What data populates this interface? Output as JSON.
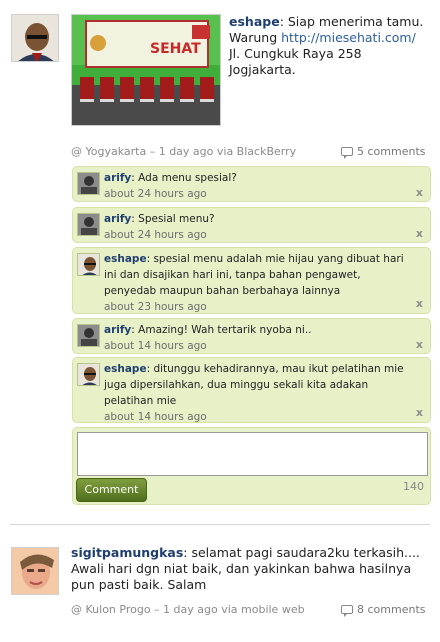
{
  "post1": {
    "username": "eshape",
    "text_before_link": ": Siap menerima tamu. Warung ",
    "link": "http://miesehati.com/",
    "text_after_link": " Jl. Cungkuk Raya 258 Jogjakarta.",
    "meta": "@ Yogyakarta – 1 day ago via BlackBerry",
    "comments_label": "5 comments",
    "photo_banner_text": "SEHAT"
  },
  "comments": [
    {
      "user": "arify",
      "text": ": Ada menu spesial?",
      "time": "about 24 hours ago",
      "close": "x"
    },
    {
      "user": "arify",
      "text": ": Spesial menu?",
      "time": "about 24 hours ago",
      "close": "x"
    },
    {
      "user": "eshape",
      "text": ": spesial menu adalah mie hijau yang dibuat hari ini dan disajikan hari ini, tanpa bahan pengawet, penyedab maupun bahan berbahaya lainnya",
      "time": "about 23 hours ago",
      "close": "x"
    },
    {
      "user": "arify",
      "text": ": Amazing! Wah tertarik nyoba ni..",
      "time": "about 14 hours ago",
      "close": "x"
    },
    {
      "user": "eshape",
      "text": ": ditunggu kehadirannya, mau ikut pelatihan mie juga dipersilahkan, dua minggu sekali kita adakan pelatihan mie",
      "time": "about 14 hours ago",
      "close": "x"
    }
  ],
  "reply": {
    "placeholder": "",
    "button_label": "Comment",
    "char_count": "140"
  },
  "post2": {
    "username": "sigitpamungkas",
    "text": ": selamat pagi saudara2ku terkasih.... Awali hari dgn niat baik, dan yakinkan bahwa hasilnya pun pasti baik. Salam",
    "meta": "@ Kulon Progo – 1 day ago via mobile web",
    "comments_label": "8 comments"
  },
  "colors": {
    "comment_bg": "#e8f0c8",
    "username": "#1f3f6f",
    "link": "#2c5f9e",
    "button": "#5b7d24"
  }
}
